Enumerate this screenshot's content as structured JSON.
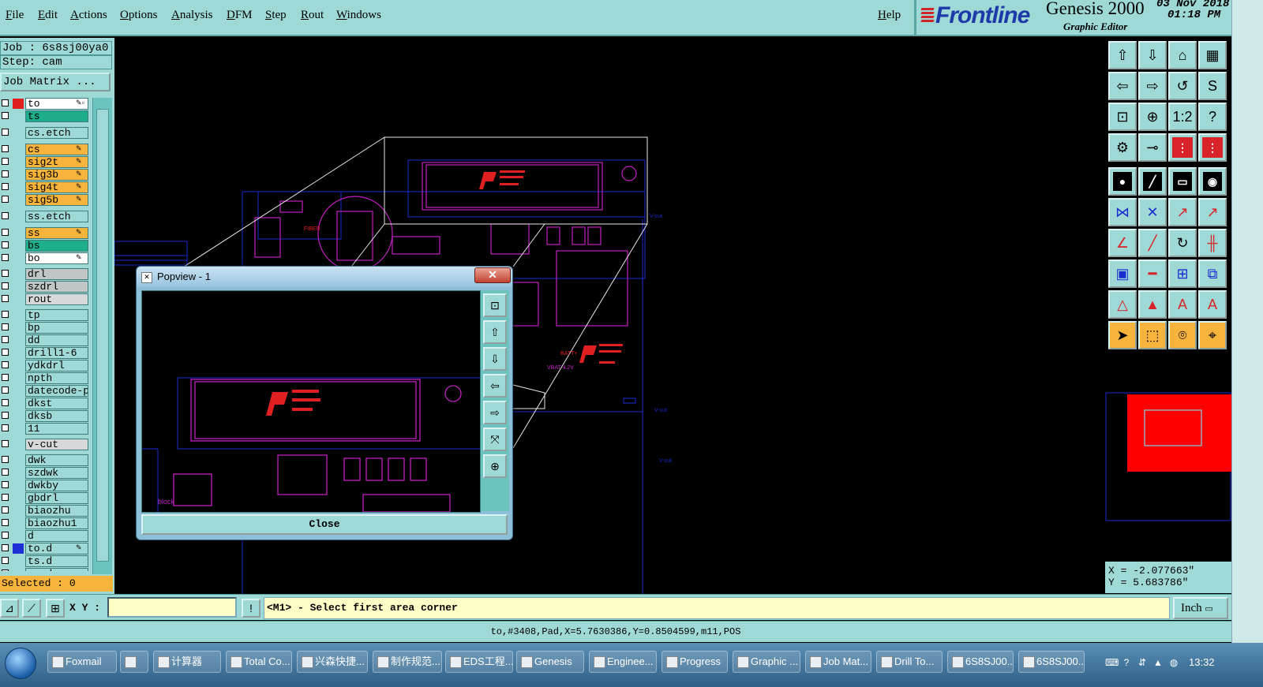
{
  "menu": [
    "File",
    "Edit",
    "Actions",
    "Options",
    "Analysis",
    "DFM",
    "Step",
    "Rout",
    "Windows"
  ],
  "help": "Help",
  "brand": {
    "logo": "Frontline",
    "product": "Genesis 2000",
    "subtitle": "Graphic Editor",
    "date": "03 Nov 2018",
    "time": "01:18 PM"
  },
  "job": "Job : 6s8sj00ya0",
  "step": "Step: cam",
  "job_matrix": "Job Matrix ...",
  "layers": [
    {
      "name": "to",
      "bg": "#ffffff",
      "swatch": "#e02020",
      "edit": "✎▫"
    },
    {
      "name": "ts",
      "bg": "#1fae8c",
      "swatch": "",
      "edit": ""
    },
    {
      "name": "cs.etch",
      "bg": "#9ed9d6",
      "swatch": "",
      "edit": ""
    },
    {
      "name": "cs",
      "bg": "#f7b43d",
      "swatch": "",
      "edit": "✎"
    },
    {
      "name": "sig2t",
      "bg": "#f7b43d",
      "swatch": "",
      "edit": "✎"
    },
    {
      "name": "sig3b",
      "bg": "#f7b43d",
      "swatch": "",
      "edit": "✎"
    },
    {
      "name": "sig4t",
      "bg": "#f7b43d",
      "swatch": "",
      "edit": "✎"
    },
    {
      "name": "sig5b",
      "bg": "#f7b43d",
      "swatch": "",
      "edit": "✎"
    },
    {
      "name": "ss.etch",
      "bg": "#9ed9d6",
      "swatch": "",
      "edit": ""
    },
    {
      "name": "ss",
      "bg": "#f7b43d",
      "swatch": "",
      "edit": "✎"
    },
    {
      "name": "bs",
      "bg": "#1fae8c",
      "swatch": "",
      "edit": ""
    },
    {
      "name": "bo",
      "bg": "#ffffff",
      "swatch": "",
      "edit": "✎"
    },
    {
      "name": "drl",
      "bg": "#bfc6c6",
      "swatch": "",
      "edit": ""
    },
    {
      "name": "szdrl",
      "bg": "#bfc6c6",
      "swatch": "",
      "edit": ""
    },
    {
      "name": "rout",
      "bg": "#d6d9d9",
      "swatch": "",
      "edit": ""
    },
    {
      "name": "tp",
      "bg": "#9ed9d6",
      "swatch": "",
      "edit": ""
    },
    {
      "name": "bp",
      "bg": "#9ed9d6",
      "swatch": "",
      "edit": ""
    },
    {
      "name": "dd",
      "bg": "#9ed9d6",
      "swatch": "",
      "edit": ""
    },
    {
      "name": "drill1-6",
      "bg": "#9ed9d6",
      "swatch": "",
      "edit": ""
    },
    {
      "name": "ydkdrl",
      "bg": "#9ed9d6",
      "swatch": "",
      "edit": ""
    },
    {
      "name": "npth",
      "bg": "#9ed9d6",
      "swatch": "",
      "edit": ""
    },
    {
      "name": "datecode-pte",
      "bg": "#9ed9d6",
      "swatch": "",
      "edit": ""
    },
    {
      "name": "dkst",
      "bg": "#9ed9d6",
      "swatch": "",
      "edit": ""
    },
    {
      "name": "dksb",
      "bg": "#9ed9d6",
      "swatch": "",
      "edit": ""
    },
    {
      "name": "11",
      "bg": "#9ed9d6",
      "swatch": "",
      "edit": ""
    },
    {
      "name": "v-cut",
      "bg": "#d6d9d9",
      "swatch": "",
      "edit": ""
    },
    {
      "name": "dwk",
      "bg": "#9ed9d6",
      "swatch": "",
      "edit": ""
    },
    {
      "name": "szdwk",
      "bg": "#9ed9d6",
      "swatch": "",
      "edit": ""
    },
    {
      "name": "dwkby",
      "bg": "#9ed9d6",
      "swatch": "",
      "edit": ""
    },
    {
      "name": "gbdrl",
      "bg": "#9ed9d6",
      "swatch": "",
      "edit": ""
    },
    {
      "name": "biaozhu",
      "bg": "#9ed9d6",
      "swatch": "",
      "edit": ""
    },
    {
      "name": "biaozhu1",
      "bg": "#9ed9d6",
      "swatch": "",
      "edit": ""
    },
    {
      "name": "d",
      "bg": "#9ed9d6",
      "swatch": "",
      "edit": ""
    },
    {
      "name": "to.d",
      "bg": "#9ed9d6",
      "swatch": "#1e2fd8",
      "edit": "✎"
    },
    {
      "name": "ts.d",
      "bg": "#9ed9d6",
      "swatch": "",
      "edit": ""
    },
    {
      "name": "cs.d",
      "bg": "#9ed9d6",
      "swatch": "",
      "edit": ""
    }
  ],
  "selected": "Selected : 0",
  "coords": {
    "x": "X = -2.077663\"",
    "y": "Y = 5.683786\""
  },
  "xy_label": "X Y :",
  "prompt": "<M1> - Select first area corner",
  "units": "Inch",
  "status": "to,#3408,Pad,X=5.7630386,Y=0.8504599,m11,POS",
  "popview": {
    "title": "Popview - 1",
    "close_label": "Close",
    "close_x": "✕"
  },
  "canvas_labels": {
    "fiber": "FIBER",
    "block": "block",
    "vcut": "V-cut",
    "batt": "BATT+",
    "vbat": "VBAT 4.2V"
  },
  "taskbar": [
    "Foxmail",
    "",
    "计算器",
    "Total Co...",
    "兴森快捷...",
    "制作规范...",
    "EDS工程...",
    "Genesis",
    "Enginee...",
    "Progress",
    "Graphic ...",
    "Job Mat...",
    "Drill To...",
    "6S8SJ00...",
    "6S8SJ00..."
  ],
  "clock": "13:32",
  "colors": {
    "panel": "#9ed9d6",
    "orange": "#f7b43d",
    "pcb_magenta": "#c020c0",
    "pcb_blue": "#1a2bd0",
    "pcb_red": "#e02020"
  }
}
